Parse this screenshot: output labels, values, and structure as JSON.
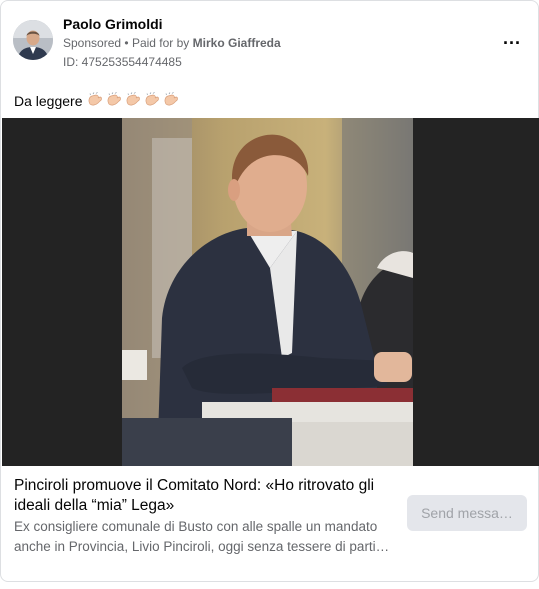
{
  "post": {
    "author": "Paolo Grimoldi",
    "sponsored_label": "Sponsored",
    "separator": "•",
    "paid_for_prefix": "Paid for by",
    "payer": "Mirko Giaffreda",
    "ad_id": "ID: 475253554474485",
    "text": "Da leggere",
    "emoji_count": 5
  },
  "link": {
    "title": "Pinciroli promuove il Comitato Nord: «Ho ritrovato gli ideali della “mia” Lega»",
    "description": "Ex consigliere comunale di Busto con alle spalle un mandato anche in Provincia, Livio Pinciroli, oggi senza tessere di parti…",
    "cta": "Send messa…"
  },
  "icons": {
    "more": "more-horizontal-icon",
    "clap": "clapping-hands-icon"
  },
  "colors": {
    "secondary_text": "#65676b",
    "button_bg": "#e4e6eb",
    "media_bg": "#232323"
  }
}
